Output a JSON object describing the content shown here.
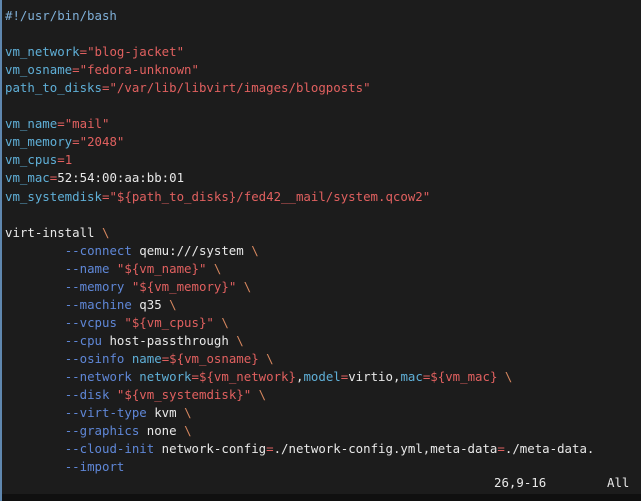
{
  "colors": {
    "background": "#1c1c1c",
    "text": "#e8e8e8",
    "shebang": "#7fafd7",
    "variable": "#5fafd7",
    "string": "#e0605f",
    "operator": "#e0605f",
    "option": "#5f87d7",
    "escape": "#d7875f"
  },
  "editor": {
    "lines": [
      [
        {
          "t": "#!/usr/bin/bash",
          "c": "shebang"
        }
      ],
      [],
      [
        {
          "t": "vm_network",
          "c": "variable"
        },
        {
          "t": "=",
          "c": "operator"
        },
        {
          "t": "\"blog-jacket\"",
          "c": "string"
        }
      ],
      [
        {
          "t": "vm_osname",
          "c": "variable"
        },
        {
          "t": "=",
          "c": "operator"
        },
        {
          "t": "\"fedora-unknown\"",
          "c": "string"
        }
      ],
      [
        {
          "t": "path_to_disks",
          "c": "variable"
        },
        {
          "t": "=",
          "c": "operator"
        },
        {
          "t": "\"/var/lib/libvirt/images/blogposts\"",
          "c": "string"
        }
      ],
      [],
      [
        {
          "t": "vm_name",
          "c": "variable"
        },
        {
          "t": "=",
          "c": "operator"
        },
        {
          "t": "\"mail\"",
          "c": "string"
        }
      ],
      [
        {
          "t": "vm_memory",
          "c": "variable"
        },
        {
          "t": "=",
          "c": "operator"
        },
        {
          "t": "\"2048\"",
          "c": "string"
        }
      ],
      [
        {
          "t": "vm_cpus",
          "c": "variable"
        },
        {
          "t": "=",
          "c": "operator"
        },
        {
          "t": "1",
          "c": "string"
        }
      ],
      [
        {
          "t": "vm_mac",
          "c": "variable"
        },
        {
          "t": "=",
          "c": "operator"
        },
        {
          "t": "52:54:00:aa:bb:01",
          "c": "text"
        }
      ],
      [
        {
          "t": "vm_systemdisk",
          "c": "variable"
        },
        {
          "t": "=",
          "c": "operator"
        },
        {
          "t": "\"${path_to_disks}/fed42__mail/system.qcow2\"",
          "c": "string"
        }
      ],
      [],
      [
        {
          "t": "virt-install ",
          "c": "text"
        },
        {
          "t": "\\",
          "c": "escape"
        }
      ],
      [
        {
          "t": "        ",
          "c": "text"
        },
        {
          "t": "--connect",
          "c": "option"
        },
        {
          "t": " qemu:///system ",
          "c": "text"
        },
        {
          "t": "\\",
          "c": "escape"
        }
      ],
      [
        {
          "t": "        ",
          "c": "text"
        },
        {
          "t": "--name",
          "c": "option"
        },
        {
          "t": " ",
          "c": "text"
        },
        {
          "t": "\"${vm_name}\"",
          "c": "string"
        },
        {
          "t": " ",
          "c": "text"
        },
        {
          "t": "\\",
          "c": "escape"
        }
      ],
      [
        {
          "t": "        ",
          "c": "text"
        },
        {
          "t": "--memory",
          "c": "option"
        },
        {
          "t": " ",
          "c": "text"
        },
        {
          "t": "\"${vm_memory}\"",
          "c": "string"
        },
        {
          "t": " ",
          "c": "text"
        },
        {
          "t": "\\",
          "c": "escape"
        }
      ],
      [
        {
          "t": "        ",
          "c": "text"
        },
        {
          "t": "--machine",
          "c": "option"
        },
        {
          "t": " q35 ",
          "c": "text"
        },
        {
          "t": "\\",
          "c": "escape"
        }
      ],
      [
        {
          "t": "        ",
          "c": "text"
        },
        {
          "t": "--vcpus",
          "c": "option"
        },
        {
          "t": " ",
          "c": "text"
        },
        {
          "t": "\"${vm_cpus}\"",
          "c": "string"
        },
        {
          "t": " ",
          "c": "text"
        },
        {
          "t": "\\",
          "c": "escape"
        }
      ],
      [
        {
          "t": "        ",
          "c": "text"
        },
        {
          "t": "--cpu",
          "c": "option"
        },
        {
          "t": " host-passthrough ",
          "c": "text"
        },
        {
          "t": "\\",
          "c": "escape"
        }
      ],
      [
        {
          "t": "        ",
          "c": "text"
        },
        {
          "t": "--osinfo",
          "c": "option"
        },
        {
          "t": " ",
          "c": "text"
        },
        {
          "t": "name",
          "c": "variable"
        },
        {
          "t": "=",
          "c": "operator"
        },
        {
          "t": "${vm_osname}",
          "c": "string"
        },
        {
          "t": " ",
          "c": "text"
        },
        {
          "t": "\\",
          "c": "escape"
        }
      ],
      [
        {
          "t": "        ",
          "c": "text"
        },
        {
          "t": "--network",
          "c": "option"
        },
        {
          "t": " ",
          "c": "text"
        },
        {
          "t": "network",
          "c": "variable"
        },
        {
          "t": "=",
          "c": "operator"
        },
        {
          "t": "${vm_network}",
          "c": "string"
        },
        {
          "t": ",",
          "c": "text"
        },
        {
          "t": "model",
          "c": "variable"
        },
        {
          "t": "=",
          "c": "operator"
        },
        {
          "t": "virtio,",
          "c": "text"
        },
        {
          "t": "mac",
          "c": "variable"
        },
        {
          "t": "=",
          "c": "operator"
        },
        {
          "t": "${vm_mac}",
          "c": "string"
        },
        {
          "t": " ",
          "c": "text"
        },
        {
          "t": "\\",
          "c": "escape"
        }
      ],
      [
        {
          "t": "        ",
          "c": "text"
        },
        {
          "t": "--disk",
          "c": "option"
        },
        {
          "t": " ",
          "c": "text"
        },
        {
          "t": "\"${vm_systemdisk}\"",
          "c": "string"
        },
        {
          "t": " ",
          "c": "text"
        },
        {
          "t": "\\",
          "c": "escape"
        }
      ],
      [
        {
          "t": "        ",
          "c": "text"
        },
        {
          "t": "--virt-type",
          "c": "option"
        },
        {
          "t": " kvm ",
          "c": "text"
        },
        {
          "t": "\\",
          "c": "escape"
        }
      ],
      [
        {
          "t": "        ",
          "c": "text"
        },
        {
          "t": "--graphics",
          "c": "option"
        },
        {
          "t": " none ",
          "c": "text"
        },
        {
          "t": "\\",
          "c": "escape"
        }
      ],
      [
        {
          "t": "        ",
          "c": "text"
        },
        {
          "t": "--cloud-init",
          "c": "option"
        },
        {
          "t": " network-config",
          "c": "text"
        },
        {
          "t": "=",
          "c": "operator"
        },
        {
          "t": "./network-config.yml,meta-data",
          "c": "text"
        },
        {
          "t": "=",
          "c": "operator"
        },
        {
          "t": "./meta-data.",
          "c": "text"
        }
      ],
      [
        {
          "t": "        ",
          "c": "text"
        },
        {
          "t": "--import",
          "c": "option"
        }
      ]
    ]
  },
  "status": {
    "position": "26,9-16",
    "scroll": "All"
  }
}
